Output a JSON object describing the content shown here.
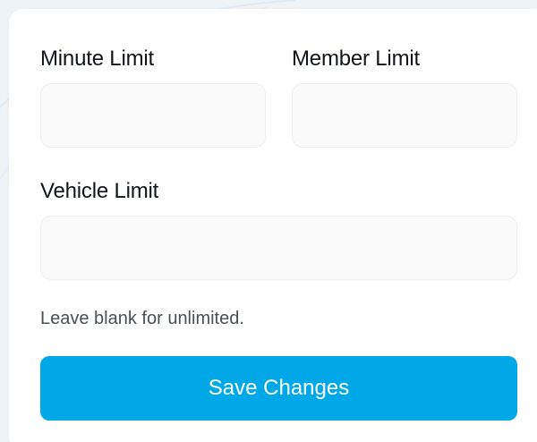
{
  "form": {
    "minute_limit": {
      "label": "Minute Limit",
      "value": "",
      "placeholder": ""
    },
    "member_limit": {
      "label": "Member Limit",
      "value": "",
      "placeholder": ""
    },
    "vehicle_limit": {
      "label": "Vehicle Limit",
      "value": "",
      "placeholder": ""
    },
    "hint": "Leave blank for unlimited.",
    "save_label": "Save Changes"
  },
  "colors": {
    "accent": "#00a8e8",
    "field_bg": "#fafafa",
    "field_border": "#eceef0",
    "page_bg": "#eef3f7"
  }
}
